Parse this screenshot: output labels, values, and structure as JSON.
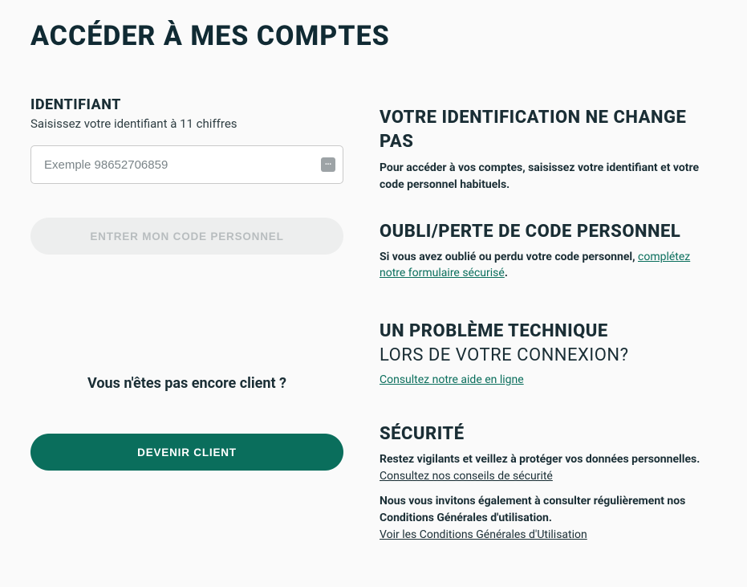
{
  "page": {
    "title": "ACCÉDER À MES COMPTES"
  },
  "form": {
    "field_label": "IDENTIFIANT",
    "field_hint": "Saisissez votre identifiant à 11 chiffres",
    "placeholder": "Exemple 98652706859",
    "submit_label": "ENTRER MON CODE PERSONNEL"
  },
  "not_client": {
    "question": "Vous n'êtes pas encore client ?",
    "cta": "DEVENIR CLIENT"
  },
  "info": {
    "identification": {
      "title": "VOTRE IDENTIFICATION NE CHANGE PAS",
      "text": "Pour accéder à vos comptes, saisissez votre identifiant et votre code personnel habituels."
    },
    "forgot": {
      "title": "OUBLI/PERTE DE CODE PERSONNEL",
      "text_prefix": "Si vous avez oublié ou perdu votre code personnel, ",
      "link": "complétez notre formulaire sécurisé",
      "text_suffix": "."
    },
    "problem": {
      "title": "UN PROBLÈME TECHNIQUE",
      "subtitle": "LORS DE VOTRE CONNEXION?",
      "link": "Consultez notre aide en ligne"
    },
    "security": {
      "title": "SÉCURITÉ",
      "warning": "Restez vigilants et veillez à protéger vos données personnelles.",
      "link1": "Consultez nos conseils de sécurité",
      "terms_text": "Nous vous invitons également à consulter régulièrement nos Conditions Générales d'utilisation.",
      "link2": "Voir les Conditions Générales d'Utilisation"
    }
  }
}
